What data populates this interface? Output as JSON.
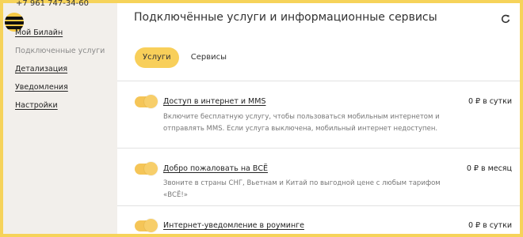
{
  "account": {
    "phone": "+7 961 747-34-60"
  },
  "sidebar": {
    "items": [
      {
        "label": "Мой Билайн"
      },
      {
        "label": "Подключенные услуги"
      },
      {
        "label": "Детализация"
      },
      {
        "label": "Уведомления"
      },
      {
        "label": "Настройки"
      }
    ]
  },
  "main": {
    "title": "Подключённые услуги и информационные сервисы",
    "tabs": [
      {
        "label": "Услуги",
        "active": true
      },
      {
        "label": "Сервисы",
        "active": false
      }
    ],
    "services": [
      {
        "name": "Доступ в интернет и MMS",
        "price": "0 ₽ в сутки",
        "description": "Включите бесплатную услугу, чтобы пользоваться мобильным интернетом и отправлять MMS. Если услуга выключена, мобильный интернет недоступен.",
        "enabled": true
      },
      {
        "name": "Добро пожаловать на ВСЁ",
        "price": "0 ₽ в месяц",
        "description": "Звоните в страны СНГ, Вьетнам и Китай по выгодной цене с любым тарифом «ВСЁ!»",
        "enabled": true
      },
      {
        "name": "Интернет-уведомление в роуминге",
        "price": "0 ₽ в сутки",
        "description": "",
        "enabled": true
      }
    ]
  },
  "colors": {
    "accent": "#f8cf5a",
    "frame": "#f6d35a",
    "toggle": "#f5c557"
  },
  "icons": {
    "refresh": "refresh-icon",
    "logo": "beeline-logo-icon"
  }
}
